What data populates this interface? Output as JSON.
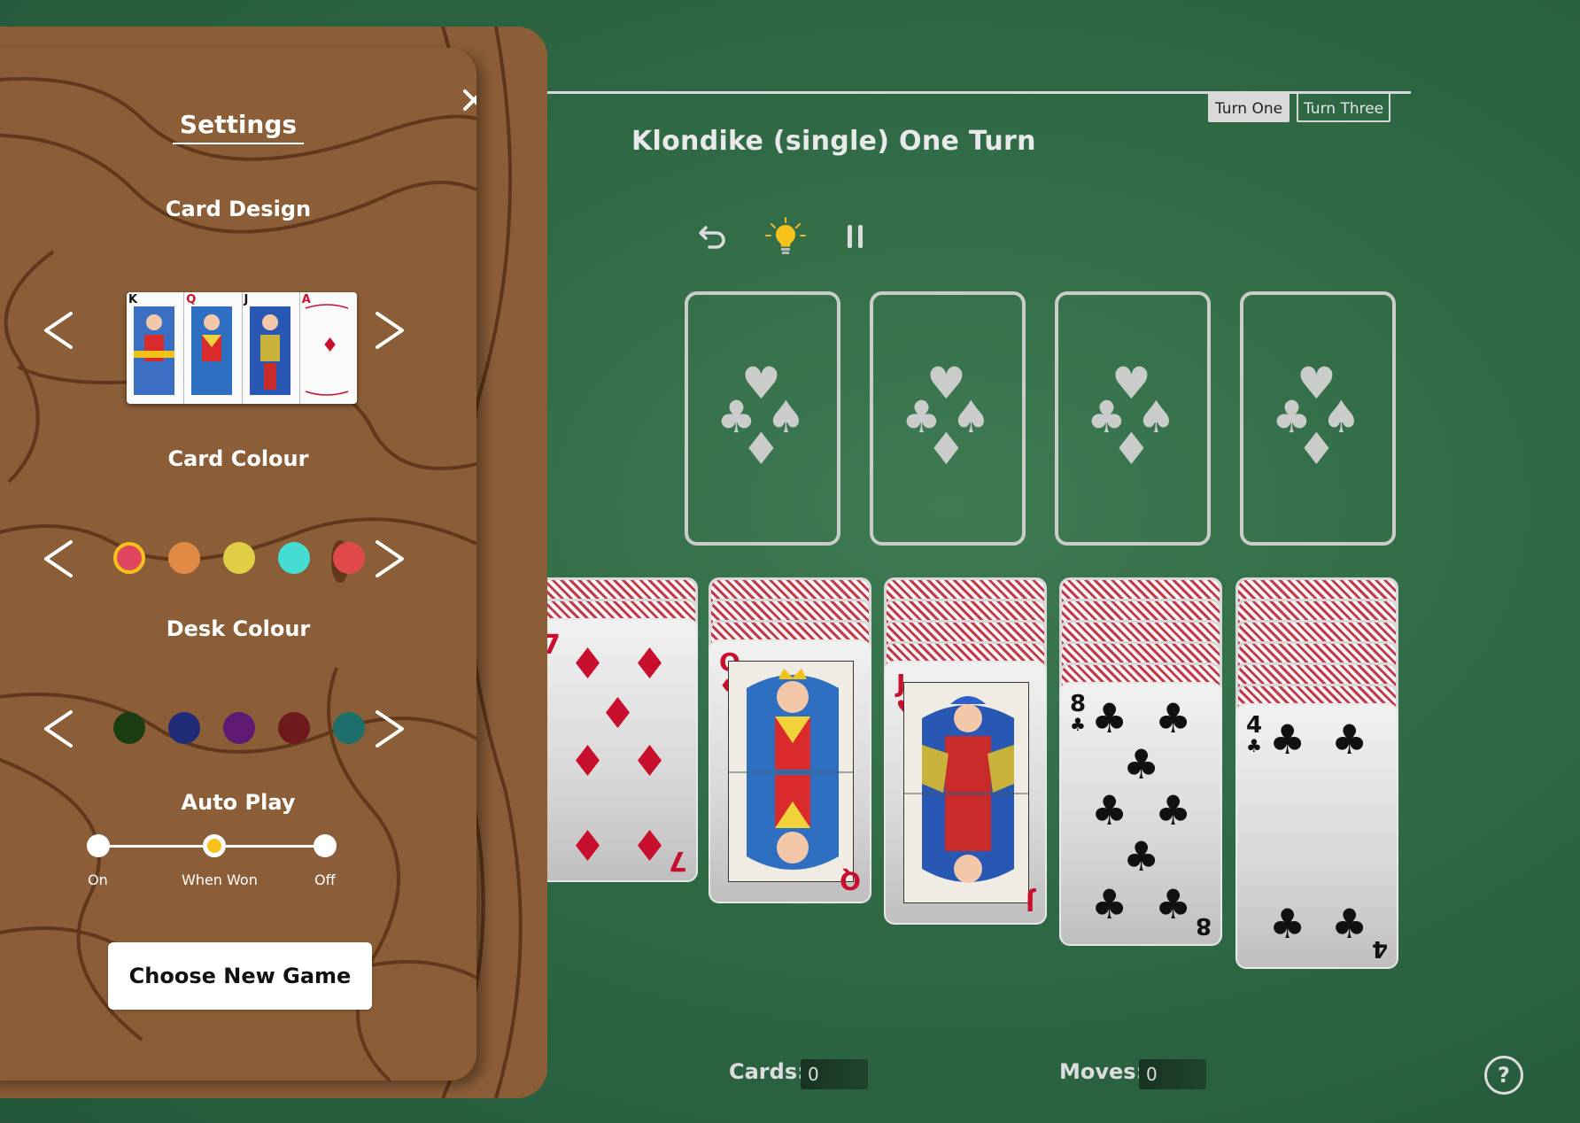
{
  "game": {
    "title": "Klondike (single) One Turn",
    "turn_modes": [
      {
        "label": "Turn One",
        "active": true
      },
      {
        "label": "Turn Three",
        "active": false
      }
    ],
    "toolbar": {
      "undo_icon": "undo-icon",
      "hint_icon": "lightbulb-icon",
      "pause_icon": "pause-icon"
    },
    "foundations": [
      {
        "suits": [
          "♣",
          "♥",
          "♠",
          "♦"
        ]
      },
      {
        "suits": [
          "♣",
          "♥",
          "♠",
          "♦"
        ]
      },
      {
        "suits": [
          "♣",
          "♥",
          "♠",
          "♦"
        ]
      },
      {
        "suits": [
          "♣",
          "♥",
          "♠",
          "♦"
        ]
      }
    ],
    "tableau": [
      {
        "face_down": 2,
        "top_card": {
          "rank": "7",
          "suit": "♦",
          "color": "red"
        }
      },
      {
        "face_down": 3,
        "top_card": {
          "rank": "Q",
          "suit": "♦",
          "color": "red"
        }
      },
      {
        "face_down": 4,
        "top_card": {
          "rank": "J",
          "suit": "♥",
          "color": "red"
        }
      },
      {
        "face_down": 5,
        "top_card": {
          "rank": "8",
          "suit": "♣",
          "color": "black"
        }
      },
      {
        "face_down": 6,
        "top_card": {
          "rank": "4",
          "suit": "♣",
          "color": "black"
        }
      }
    ],
    "stats": {
      "cards_label": "Cards:",
      "cards_value": "0",
      "moves_label": "Moves:",
      "moves_value": "0"
    },
    "help_label": "?"
  },
  "settings": {
    "title": "Settings",
    "close_icon": "close-icon",
    "card_design": {
      "label": "Card Design",
      "preview_cards": [
        {
          "rank": "K",
          "suit": "♣",
          "color": "black"
        },
        {
          "rank": "Q",
          "suit": "♥",
          "color": "red"
        },
        {
          "rank": "J",
          "suit": "♠",
          "color": "black"
        },
        {
          "rank": "A",
          "suit": "♦",
          "color": "red"
        }
      ],
      "prev_label": "<",
      "next_label": ">"
    },
    "card_colour": {
      "label": "Card Colour",
      "options": [
        "#e0475f",
        "#e08a45",
        "#e0cf45",
        "#45ddd3",
        "#e04a4a"
      ],
      "selected_index": 0,
      "prev_label": "<",
      "next_label": ">"
    },
    "desk_colour": {
      "label": "Desk Colour",
      "options": [
        "#1b3d14",
        "#1f2d78",
        "#5f1a74",
        "#6e1a1c",
        "#1c6f6b"
      ],
      "selected_index": null,
      "prev_label": "<",
      "next_label": ">"
    },
    "auto_play": {
      "label": "Auto Play",
      "options": [
        "On",
        "When Won",
        "Off"
      ],
      "selected_index": 1
    },
    "new_game_label": "Choose New Game"
  },
  "colors": {
    "desk_green": "#2f6a45",
    "wood": "#8b5e38",
    "wood_grain": "#5a3218",
    "accent_yellow": "#f6c21c"
  }
}
